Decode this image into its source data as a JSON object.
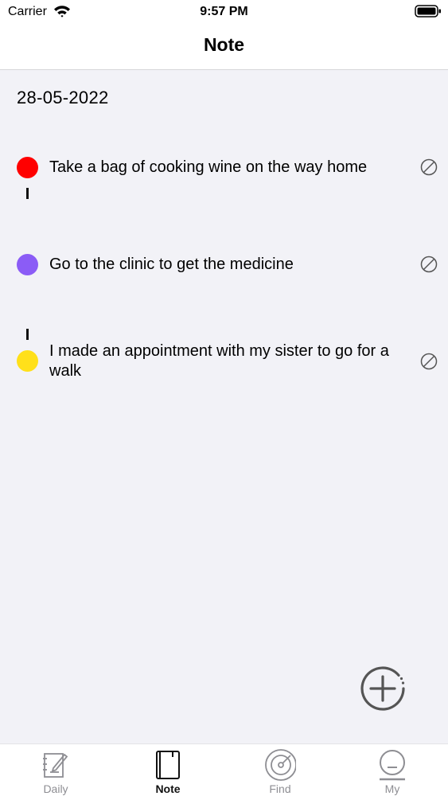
{
  "status_bar": {
    "carrier": "Carrier",
    "time": "9:57 PM"
  },
  "nav": {
    "title": "Note"
  },
  "date": "28-05-2022",
  "notes": [
    {
      "text": "Take a bag of cooking wine on the way home",
      "color": "#ff0000",
      "icon": "cancel-icon"
    },
    {
      "text": "Go to the clinic to get the medicine",
      "color": "#8b5cf6",
      "icon": "cancel-icon"
    },
    {
      "text": "I made an appointment with my sister to go for a walk",
      "color": "#ffe01a",
      "icon": "cancel-icon"
    }
  ],
  "fab": {
    "icon": "plus-circle-icon"
  },
  "tabs": [
    {
      "label": "Daily",
      "icon": "notepad-pencil-icon",
      "active": false
    },
    {
      "label": "Note",
      "icon": "notebook-icon",
      "active": true
    },
    {
      "label": "Find",
      "icon": "radar-icon",
      "active": false
    },
    {
      "label": "My",
      "icon": "profile-icon",
      "active": false
    }
  ]
}
